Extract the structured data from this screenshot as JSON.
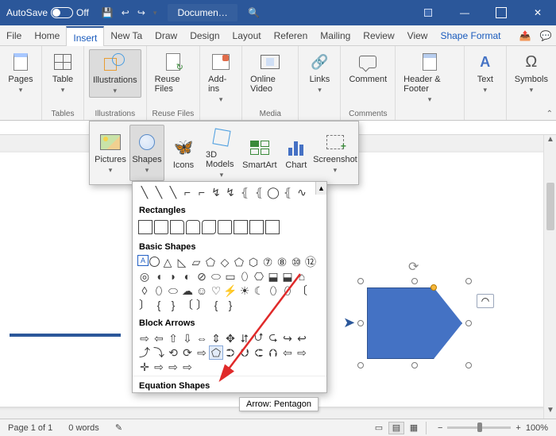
{
  "titlebar": {
    "autosave_label": "AutoSave",
    "autosave_state": "Off",
    "doc_title": "Documen…"
  },
  "tabs": {
    "file": "File",
    "home": "Home",
    "insert": "Insert",
    "newtab": "New Ta",
    "draw": "Draw",
    "design": "Design",
    "layout": "Layout",
    "references": "Referen",
    "mailings": "Mailing",
    "review": "Review",
    "view": "View",
    "shape_format": "Shape Format"
  },
  "ribbon": {
    "pages": "Pages",
    "table": "Table",
    "illustrations": "Illustrations",
    "reuse_files": "Reuse Files",
    "addins": "Add-ins",
    "online_video": "Online Video",
    "links": "Links",
    "comment": "Comment",
    "header_footer": "Header & Footer",
    "text": "Text",
    "symbols": "Symbols",
    "groups": {
      "tables": "Tables",
      "illustrations": "Illustrations",
      "reuse": "Reuse Files",
      "media": "Media",
      "comments": "Comments"
    }
  },
  "illus_panel": {
    "pictures": "Pictures",
    "shapes": "Shapes",
    "icons": "Icons",
    "models": "3D Models",
    "smartart": "SmartArt",
    "chart": "Chart",
    "screenshot": "Screenshot"
  },
  "shapes_gallery": {
    "rectangles": "Rectangles",
    "basic_shapes": "Basic Shapes",
    "block_arrows": "Block Arrows",
    "equation_shapes": "Equation Shapes"
  },
  "tooltip": "Arrow: Pentagon",
  "status": {
    "page": "Page 1 of 1",
    "words": "0 words",
    "zoom": "100%"
  }
}
